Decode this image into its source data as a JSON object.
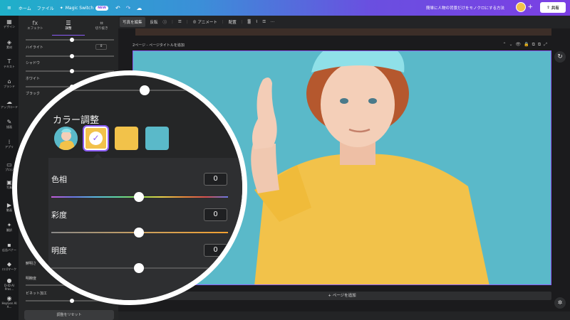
{
  "colors": {
    "accent": "#8b5cf6",
    "photo_bg": "#5ab9c9",
    "shirt_yellow": "#f2c24a",
    "panel_bg": "#252627"
  },
  "topbar": {
    "home": "ホーム",
    "file": "ファイル",
    "magic_switch": "Magic Switch",
    "new_badge": "NEW",
    "doc_title": "簡単に人物の背景だけをモノクロにする方法",
    "share": "共有"
  },
  "rail": {
    "items": [
      {
        "label": "デザイン",
        "icon": "▦"
      },
      {
        "label": "素材",
        "icon": "◈"
      },
      {
        "label": "テキスト",
        "icon": "T"
      },
      {
        "label": "ブランド",
        "icon": "⌂"
      },
      {
        "label": "アップロード",
        "icon": "☁"
      },
      {
        "label": "描画",
        "icon": "✎"
      },
      {
        "label": "アプリ",
        "icon": "⁞"
      },
      {
        "label": "プロジ",
        "icon": "▭"
      },
      {
        "label": "写真",
        "icon": "▣"
      },
      {
        "label": "動画",
        "icon": "▶"
      },
      {
        "label": "翻訳",
        "icon": "✦"
      },
      {
        "label": "広告バナー",
        "icon": "▪"
      },
      {
        "label": "ロゴマーク",
        "icon": "◆"
      },
      {
        "label": "D-ID AI Pres...",
        "icon": "●"
      },
      {
        "label": "HeyGen AI A...",
        "icon": "◉"
      }
    ]
  },
  "panel": {
    "tabs": [
      {
        "label": "エフェクト",
        "icon": "fx"
      },
      {
        "label": "調整",
        "icon": "☰"
      },
      {
        "label": "切り抜き",
        "icon": "⌗"
      }
    ],
    "rows": [
      {
        "label": "ハイライト",
        "value": "0"
      },
      {
        "label": "シャドウ",
        "value": ""
      },
      {
        "label": "ホワイト",
        "value": ""
      },
      {
        "label": "ブラック",
        "value": ""
      }
    ],
    "lower_rows": [
      {
        "label": "鮮明さ"
      },
      {
        "label": "明瞭度"
      },
      {
        "label": "ビネット加工"
      }
    ],
    "reset": "調整をリセット"
  },
  "canvas": {
    "tools": {
      "edit_photo": "写真を編集",
      "flip": "反転",
      "animate": "アニメート",
      "arrange": "配置"
    },
    "page_label": "2ページ - ページタイトルを追加",
    "add_page": "+ ページを追加"
  },
  "magnifier": {
    "title": "カラー調整",
    "sliders": [
      {
        "label": "色相",
        "value": "0",
        "level": 0
      },
      {
        "label": "彩度",
        "value": "0",
        "level": 0
      },
      {
        "label": "明度",
        "value": "0",
        "level": 0
      }
    ]
  }
}
